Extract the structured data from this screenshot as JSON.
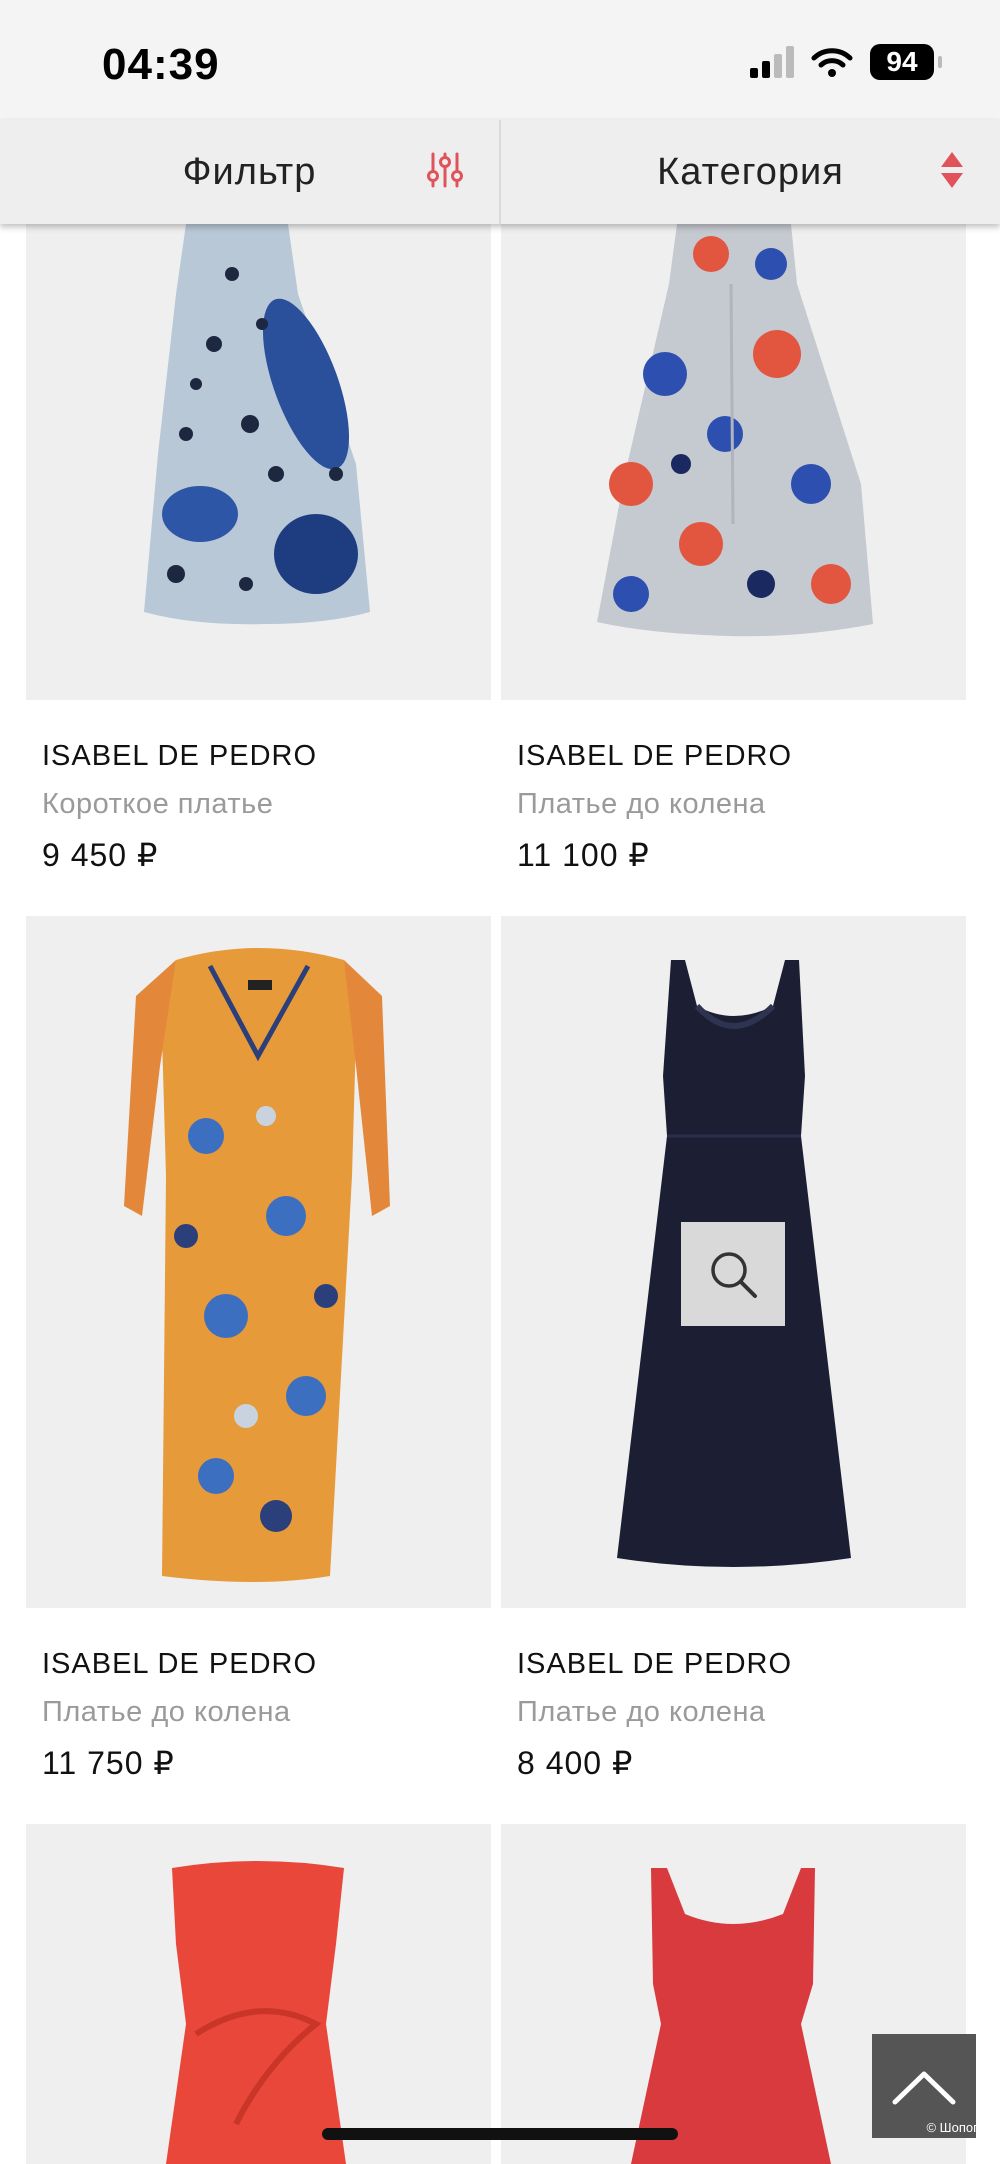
{
  "status_bar": {
    "time": "04:39",
    "battery": "94"
  },
  "toolbar": {
    "filter_label": "Фильтр",
    "category_label": "Категория"
  },
  "products": [
    {
      "brand": "ISABEL DE PEDRO",
      "type": "Короткое платье",
      "price": "9 450 ₽"
    },
    {
      "brand": "ISABEL DE PEDRO",
      "type": "Платье до колена",
      "price": "11 100 ₽"
    },
    {
      "brand": "ISABEL DE PEDRO",
      "type": "Платье до колена",
      "price": "11 750 ₽"
    },
    {
      "brand": "ISABEL DE PEDRO",
      "type": "Платье до колена",
      "price": "8 400 ₽"
    }
  ],
  "watermark": "© Шопого..",
  "colors": {
    "accent": "#e0535a",
    "card_bg": "#efefef",
    "muted_text": "#9a9a9a"
  }
}
